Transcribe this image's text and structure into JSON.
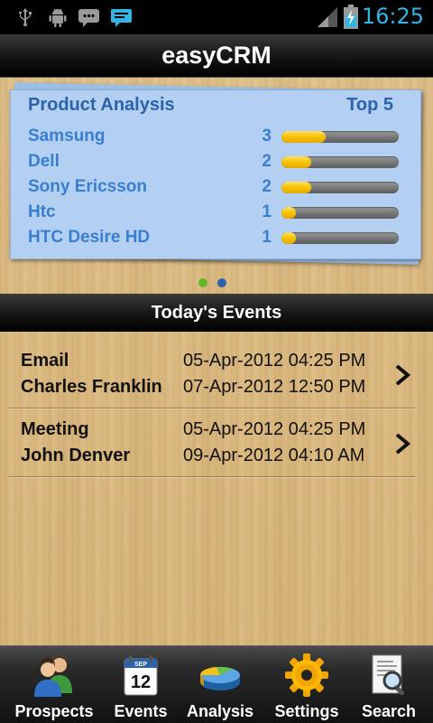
{
  "status_bar": {
    "time": "16:25",
    "accent": "#33b5e5"
  },
  "app": {
    "title": "easyCRM"
  },
  "analysis": {
    "title": "Product Analysis",
    "badge": "Top 5",
    "bar_max": 8,
    "items": [
      {
        "name": "Samsung",
        "count": "3",
        "value": 3
      },
      {
        "name": "Dell",
        "count": "2",
        "value": 2
      },
      {
        "name": "Sony Ericsson",
        "count": "2",
        "value": 2
      },
      {
        "name": "Htc",
        "count": "1",
        "value": 1
      },
      {
        "name": "HTC Desire HD",
        "count": "1",
        "value": 1
      }
    ],
    "page_indicator": {
      "pages": 2,
      "active": 0,
      "active_color": "#5fb82a",
      "inactive_color": "#2b62a8"
    }
  },
  "events": {
    "header": "Today's Events",
    "items": [
      {
        "type": "Email",
        "contact": "Charles Franklin",
        "date1": "05-Apr-2012 04:25 PM",
        "date2": "07-Apr-2012 12:50 PM"
      },
      {
        "type": "Meeting",
        "contact": "John Denver",
        "date1": "05-Apr-2012 04:25 PM",
        "date2": "09-Apr-2012 04:10 AM"
      }
    ]
  },
  "nav": {
    "items": [
      {
        "label": "Prospects",
        "icon": "prospects-icon"
      },
      {
        "label": "Events",
        "icon": "calendar-icon",
        "calendar_month": "SEP",
        "calendar_day": "12"
      },
      {
        "label": "Analysis",
        "icon": "pie-chart-icon"
      },
      {
        "label": "Settings",
        "icon": "gear-icon"
      },
      {
        "label": "Search",
        "icon": "search-document-icon"
      }
    ]
  }
}
